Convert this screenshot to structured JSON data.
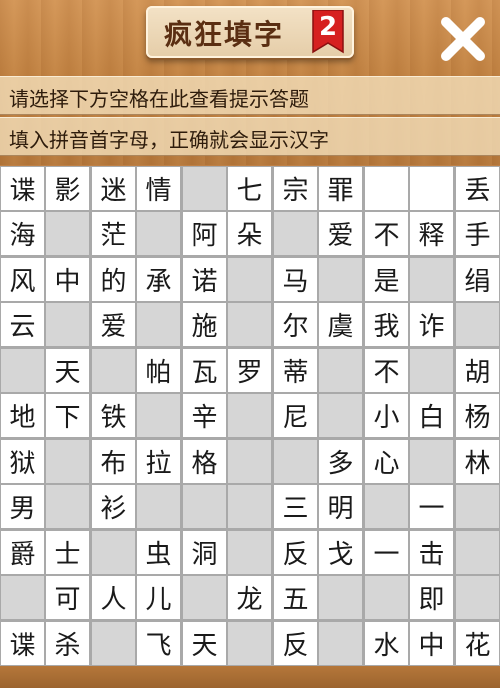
{
  "header": {
    "title": "疯狂填字",
    "level": "2",
    "close_icon": "close-x-icon"
  },
  "hints": {
    "line1": "请选择下方空格在此查看提示答题",
    "line2": "填入拼音首字母，正确就会显示汉字"
  },
  "colors": {
    "wood": "#c0803f",
    "badge_red": "#d62020",
    "cell_white": "#ffffff",
    "cell_blocked": "#d6d6d6"
  },
  "grid": {
    "rows": [
      [
        "谍",
        "影",
        "迷",
        "情",
        null,
        "七",
        "宗",
        "罪",
        "",
        "",
        "丢"
      ],
      [
        "海",
        null,
        "茫",
        null,
        "阿",
        "朵",
        null,
        "爱",
        "不",
        "释",
        "手"
      ],
      [
        "风",
        "中",
        "的",
        "承",
        "诺",
        null,
        "马",
        null,
        "是",
        null,
        "绢"
      ],
      [
        "云",
        null,
        "爱",
        null,
        "施",
        null,
        "尔",
        "虞",
        "我",
        "诈",
        null
      ],
      [
        null,
        "天",
        null,
        "帕",
        "瓦",
        "罗",
        "蒂",
        null,
        "不",
        null,
        "胡"
      ],
      [
        "地",
        "下",
        "铁",
        null,
        "辛",
        null,
        "尼",
        null,
        "小",
        "白",
        "杨"
      ],
      [
        "狱",
        null,
        "布",
        "拉",
        "格",
        null,
        null,
        "多",
        "心",
        null,
        "林"
      ],
      [
        "男",
        null,
        "衫",
        null,
        null,
        null,
        "三",
        "明",
        null,
        "一",
        null
      ],
      [
        "爵",
        "士",
        null,
        "虫",
        "洞",
        null,
        "反",
        "戈",
        "一",
        "击",
        null
      ],
      [
        null,
        "可",
        "人",
        "儿",
        null,
        "龙",
        "五",
        null,
        null,
        "即",
        null
      ],
      [
        "谍",
        "杀",
        null,
        "飞",
        "天",
        null,
        "反",
        null,
        "水",
        "中",
        "花"
      ]
    ]
  }
}
